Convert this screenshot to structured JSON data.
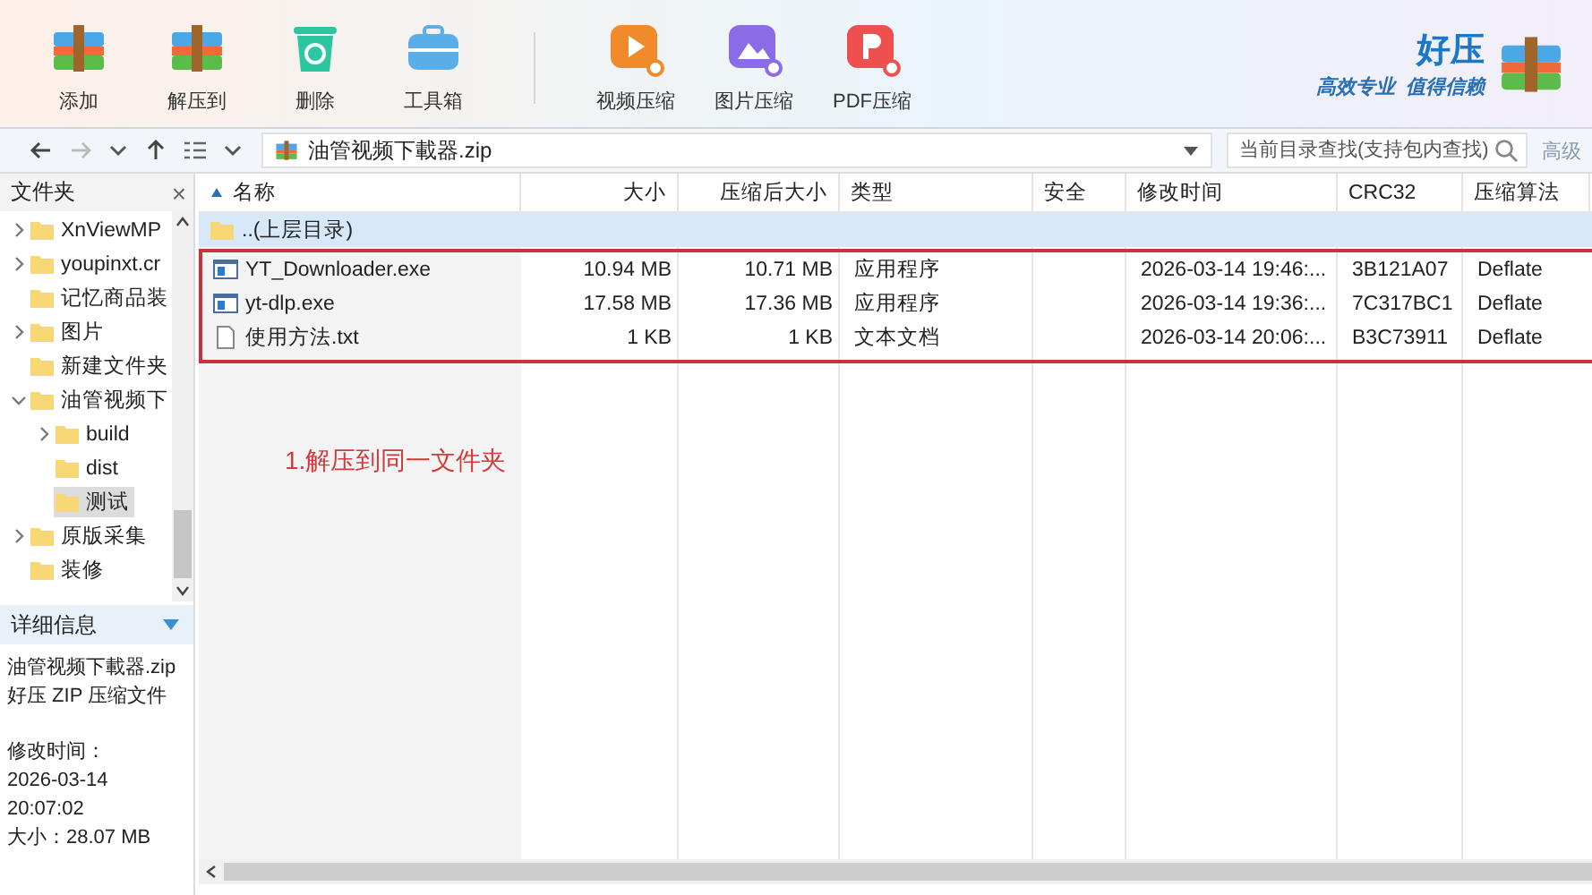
{
  "toolbar": {
    "buttons": [
      {
        "label": "添加"
      },
      {
        "label": "解压到"
      },
      {
        "label": "删除"
      },
      {
        "label": "工具箱"
      },
      {
        "label": "视频压缩"
      },
      {
        "label": "图片压缩"
      },
      {
        "label": "PDF压缩"
      }
    ],
    "logo": {
      "name": "好压",
      "tagline": "高效专业  值得信赖"
    }
  },
  "nav": {
    "back_enabled": true,
    "forward_enabled": false,
    "path": "油管视频下載器.zip",
    "search": {
      "placeholder": "当前目录查找(支持包内查找)"
    },
    "advanced": "高级"
  },
  "sidebar": {
    "title": "文件夹",
    "close": "×",
    "tree": [
      {
        "label": "XnViewMP",
        "expanded": false,
        "selected": false
      },
      {
        "label": "youpinxt.cr",
        "expanded": false,
        "selected": false
      },
      {
        "label": "记忆商品装",
        "selected": false
      },
      {
        "label": "图片",
        "expanded": false,
        "selected": false
      },
      {
        "label": "新建文件夹",
        "selected": false
      },
      {
        "label": "油管视频下",
        "expanded": true,
        "selected": false,
        "children": [
          {
            "label": "build",
            "expanded": false,
            "selected": false
          },
          {
            "label": "dist",
            "selected": false
          },
          {
            "label": "测试",
            "selected": true
          }
        ]
      },
      {
        "label": "原版采集",
        "expanded": false,
        "selected": false
      },
      {
        "label": "装修",
        "selected": false
      }
    ],
    "details": {
      "title": "详细信息",
      "groups": [
        [
          "油管视频下載器.zip",
          "好压 ZIP 压缩文件"
        ],
        [
          "修改时间：",
          "2026-03-14",
          "20:07:02",
          "大小：28.07 MB"
        ]
      ]
    }
  },
  "table": {
    "columns": [
      "名称",
      "大小",
      "压缩后大小",
      "类型",
      "安全",
      "修改时间",
      "CRC32",
      "压缩算法"
    ],
    "parent_row": {
      "kind": "folder",
      "name": "..(上层目录)",
      "selected": true
    },
    "rows": [
      {
        "kind": "exe",
        "name": "YT_Downloader.exe",
        "size": "10.94 MB",
        "packed": "10.71 MB",
        "type": "应用程序",
        "modified": "2026-03-14 19:46:...",
        "crc": "3B121A07",
        "method": "Deflate",
        "selected": false
      },
      {
        "kind": "exe",
        "name": "yt-dlp.exe",
        "size": "17.58 MB",
        "packed": "17.36 MB",
        "type": "应用程序",
        "modified": "2026-03-14 19:36:...",
        "crc": "7C317BC1",
        "method": "Deflate",
        "selected": false
      },
      {
        "kind": "txt",
        "name": "使用方法.txt",
        "size": "1 KB",
        "packed": "1 KB",
        "type": "文本文档",
        "modified": "2026-03-14 20:06:...",
        "crc": "B3C73911",
        "method": "Deflate",
        "selected": false
      }
    ]
  },
  "annotation": "1.解压到同一文件夹"
}
